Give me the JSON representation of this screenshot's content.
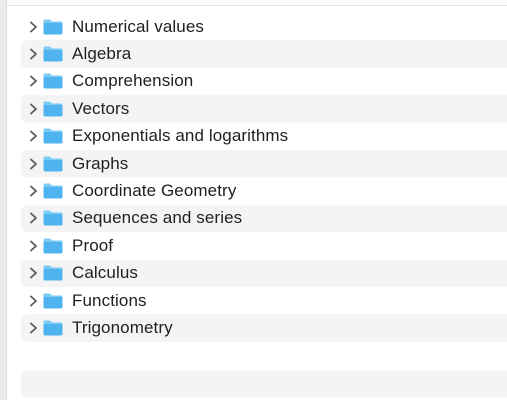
{
  "colors": {
    "folder_body": "#4fb3f0",
    "folder_tab": "#7ccaf6",
    "chevron": "#5a5a5a",
    "stripe": "#f4f4f4"
  },
  "folders": [
    {
      "label": "Numerical values",
      "icon": "folder-icon"
    },
    {
      "label": "Algebra",
      "icon": "folder-icon"
    },
    {
      "label": "Comprehension",
      "icon": "folder-icon"
    },
    {
      "label": "Vectors",
      "icon": "folder-icon"
    },
    {
      "label": "Exponentials and logarithms",
      "icon": "folder-icon"
    },
    {
      "label": "Graphs",
      "icon": "folder-icon"
    },
    {
      "label": "Coordinate Geometry",
      "icon": "folder-icon"
    },
    {
      "label": "Sequences and series",
      "icon": "folder-icon"
    },
    {
      "label": "Proof",
      "icon": "folder-icon"
    },
    {
      "label": "Calculus",
      "icon": "folder-icon"
    },
    {
      "label": "Functions",
      "icon": "folder-icon"
    },
    {
      "label": "Trigonometry",
      "icon": "folder-icon"
    }
  ]
}
